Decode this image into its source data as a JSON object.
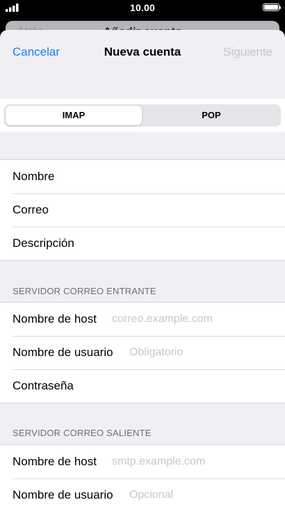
{
  "status_bar": {
    "time": "10.00",
    "signal_icon": "signal-bars-icon",
    "battery_icon": "battery-full-icon"
  },
  "background_sheet": {
    "back_label": "Atrás",
    "title": "Añadir cuenta"
  },
  "nav": {
    "cancel_label": "Cancelar",
    "title": "Nueva cuenta",
    "next_label": "Siguiente"
  },
  "segment": {
    "options": [
      "IMAP",
      "POP"
    ],
    "selected": "IMAP"
  },
  "account_fields": [
    {
      "label": "Nombre"
    },
    {
      "label": "Correo"
    },
    {
      "label": "Descripción"
    }
  ],
  "incoming": {
    "header": "SERVIDOR CORREO ENTRANTE",
    "fields": [
      {
        "label": "Nombre de host",
        "placeholder": "correo.example.com"
      },
      {
        "label": "Nombre de usuario",
        "placeholder": "Obligatorio"
      },
      {
        "label": "Contraseña",
        "placeholder": ""
      }
    ]
  },
  "outgoing": {
    "header": "SERVIDOR CORREO SALIENTE",
    "fields": [
      {
        "label": "Nombre de host",
        "placeholder": "smtp.example.com"
      },
      {
        "label": "Nombre de usuario",
        "placeholder": "Opcional"
      }
    ]
  },
  "colors": {
    "accent": "#1a7ef5",
    "disabled": "#c4c4c9",
    "placeholder": "#c7c7cc",
    "grouped_background": "#efeff4"
  }
}
